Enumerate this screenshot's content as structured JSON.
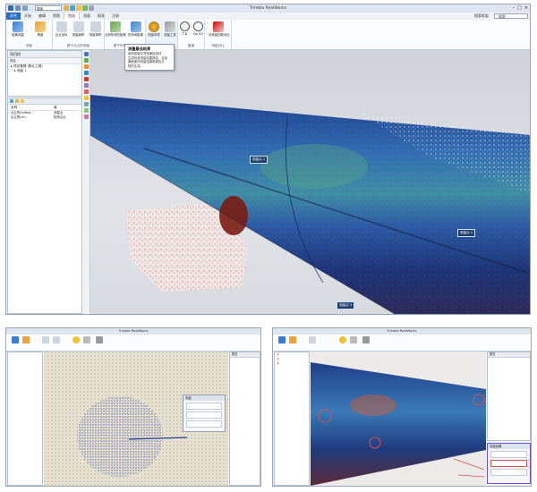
{
  "main": {
    "app_title": "Trimble RealWorks",
    "quick_search": "搜索",
    "tabs": [
      "文件",
      "开始",
      "编辑",
      "视图",
      "首选",
      "测量",
      "报表",
      "注册"
    ],
    "active_tab_index": 4,
    "search_label": "搜索框架",
    "search_value": "搜索",
    "ribbon_groups": [
      {
        "label": "测量",
        "buttons": [
          "距离测量",
          "角度"
        ]
      },
      {
        "label": "基于点云的测量",
        "buttons": [
          "点云坐标",
          "测量面积",
          "测量体积"
        ]
      },
      {
        "label": "基于形状的测量",
        "buttons": [
          "点到形状的距离",
          "形状间距离"
        ]
      },
      {
        "label": "测量工作流程",
        "buttons": [
          "测量向导",
          "测量工具"
        ]
      },
      {
        "label": "管道",
        "buttons": [
          "T-D",
          "Dn-En"
        ]
      },
      {
        "label": "测量对比",
        "buttons": [
          "对测量的新对比"
        ]
      }
    ],
    "tooltip": {
      "title": "测量最佳结果",
      "lines": [
        "使用测量向导快速检测并",
        "生成标准测量结果报告，包括",
        "偏差面的测量结果和报告文",
        "档的生成。"
      ]
    },
    "project_panel": {
      "title": "项目树",
      "toolbar_value": "项目",
      "items": [
        "项目管理 (默认工程)",
        "测量 1"
      ]
    },
    "props_panel": {
      "headers": [
        "名称",
        "值"
      ],
      "rows": [
        {
          "name": "点云的Unified...",
          "value": "测量点"
        },
        {
          "name": "点云的Uni...",
          "value": "检测点云"
        }
      ]
    },
    "labels": [
      "测量点 1",
      "测量点 2",
      "测量点 3"
    ]
  },
  "bottom_left": {
    "app_title": "Trimble RealWorks",
    "dialog_title": "测量",
    "side_title": "属性"
  },
  "bottom_right": {
    "app_title": "Trimble RealWorks",
    "side_title": "属性",
    "dialog_title": "测量结果"
  },
  "colors": {
    "accent": "#2b6cc4",
    "highlight": "#6d4fd6",
    "marker": "#d9534f"
  }
}
